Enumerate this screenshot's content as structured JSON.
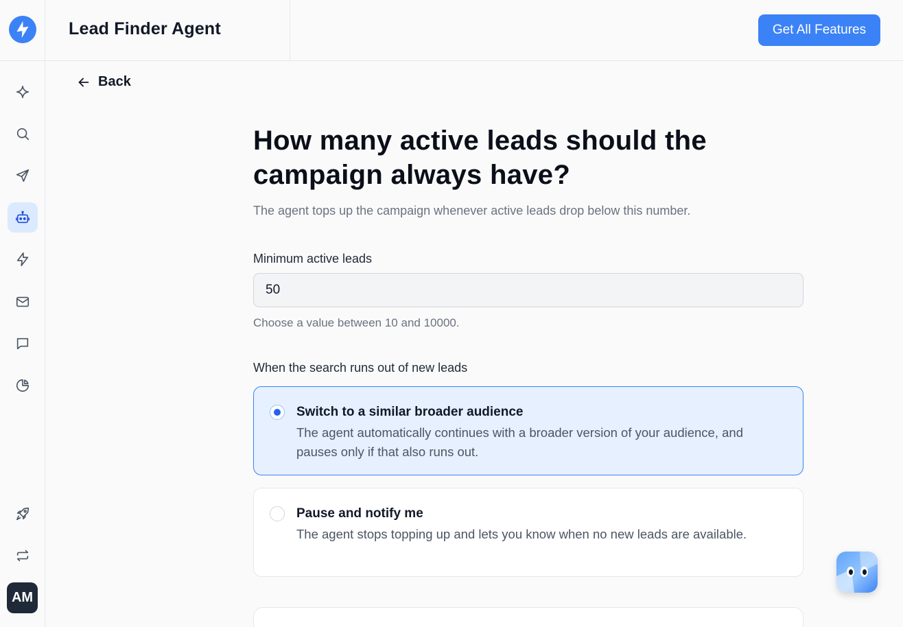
{
  "app": {
    "title": "Lead Finder Agent",
    "cta_label": "Get All Features",
    "accent_color": "#3b82f6"
  },
  "sidebar": {
    "items": [
      {
        "icon": "sparkle-icon",
        "active": false
      },
      {
        "icon": "search-icon",
        "active": false
      },
      {
        "icon": "send-icon",
        "active": false
      },
      {
        "icon": "robot-icon",
        "active": true
      },
      {
        "icon": "lightning-icon",
        "active": false
      },
      {
        "icon": "mail-icon",
        "active": false
      },
      {
        "icon": "chat-icon",
        "active": false
      },
      {
        "icon": "pie-chart-icon",
        "active": false
      }
    ],
    "bottom_items": [
      {
        "icon": "rocket-icon"
      },
      {
        "icon": "repeat-icon"
      }
    ],
    "avatar_initials": "AM"
  },
  "nav": {
    "back_label": "Back"
  },
  "main": {
    "heading": "How many active leads should the campaign always have?",
    "subtitle": "The agent tops up the campaign whenever active leads drop below this number.",
    "min_leads": {
      "label": "Minimum active leads",
      "value": "50",
      "hint": "Choose a value between 10 and 10000."
    },
    "fallback": {
      "label": "When the search runs out of new leads",
      "options": [
        {
          "title": "Switch to a similar broader audience",
          "description": "The agent automatically continues with a broader version of your audience, and pauses only if that also runs out.",
          "selected": true
        },
        {
          "title": "Pause and notify me",
          "description": "The agent stops topping up and lets you know when no new leads are available.",
          "selected": false
        }
      ]
    }
  }
}
